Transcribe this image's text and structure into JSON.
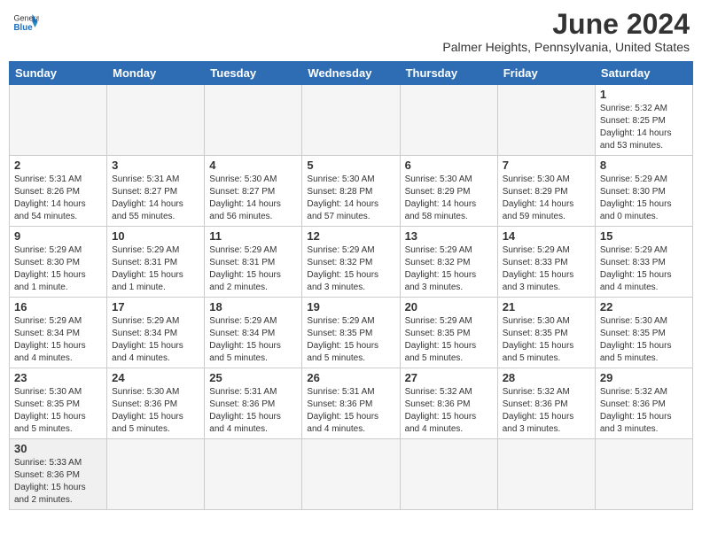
{
  "header": {
    "logo_general": "General",
    "logo_blue": "Blue",
    "month_title": "June 2024",
    "location": "Palmer Heights, Pennsylvania, United States"
  },
  "days_of_week": [
    "Sunday",
    "Monday",
    "Tuesday",
    "Wednesday",
    "Thursday",
    "Friday",
    "Saturday"
  ],
  "weeks": [
    [
      {
        "day": "",
        "info": ""
      },
      {
        "day": "",
        "info": ""
      },
      {
        "day": "",
        "info": ""
      },
      {
        "day": "",
        "info": ""
      },
      {
        "day": "",
        "info": ""
      },
      {
        "day": "",
        "info": ""
      },
      {
        "day": "1",
        "info": "Sunrise: 5:32 AM\nSunset: 8:25 PM\nDaylight: 14 hours\nand 53 minutes."
      }
    ],
    [
      {
        "day": "2",
        "info": "Sunrise: 5:31 AM\nSunset: 8:26 PM\nDaylight: 14 hours\nand 54 minutes."
      },
      {
        "day": "3",
        "info": "Sunrise: 5:31 AM\nSunset: 8:27 PM\nDaylight: 14 hours\nand 55 minutes."
      },
      {
        "day": "4",
        "info": "Sunrise: 5:30 AM\nSunset: 8:27 PM\nDaylight: 14 hours\nand 56 minutes."
      },
      {
        "day": "5",
        "info": "Sunrise: 5:30 AM\nSunset: 8:28 PM\nDaylight: 14 hours\nand 57 minutes."
      },
      {
        "day": "6",
        "info": "Sunrise: 5:30 AM\nSunset: 8:29 PM\nDaylight: 14 hours\nand 58 minutes."
      },
      {
        "day": "7",
        "info": "Sunrise: 5:30 AM\nSunset: 8:29 PM\nDaylight: 14 hours\nand 59 minutes."
      },
      {
        "day": "8",
        "info": "Sunrise: 5:29 AM\nSunset: 8:30 PM\nDaylight: 15 hours\nand 0 minutes."
      }
    ],
    [
      {
        "day": "9",
        "info": "Sunrise: 5:29 AM\nSunset: 8:30 PM\nDaylight: 15 hours\nand 1 minute."
      },
      {
        "day": "10",
        "info": "Sunrise: 5:29 AM\nSunset: 8:31 PM\nDaylight: 15 hours\nand 1 minute."
      },
      {
        "day": "11",
        "info": "Sunrise: 5:29 AM\nSunset: 8:31 PM\nDaylight: 15 hours\nand 2 minutes."
      },
      {
        "day": "12",
        "info": "Sunrise: 5:29 AM\nSunset: 8:32 PM\nDaylight: 15 hours\nand 3 minutes."
      },
      {
        "day": "13",
        "info": "Sunrise: 5:29 AM\nSunset: 8:32 PM\nDaylight: 15 hours\nand 3 minutes."
      },
      {
        "day": "14",
        "info": "Sunrise: 5:29 AM\nSunset: 8:33 PM\nDaylight: 15 hours\nand 3 minutes."
      },
      {
        "day": "15",
        "info": "Sunrise: 5:29 AM\nSunset: 8:33 PM\nDaylight: 15 hours\nand 4 minutes."
      }
    ],
    [
      {
        "day": "16",
        "info": "Sunrise: 5:29 AM\nSunset: 8:34 PM\nDaylight: 15 hours\nand 4 minutes."
      },
      {
        "day": "17",
        "info": "Sunrise: 5:29 AM\nSunset: 8:34 PM\nDaylight: 15 hours\nand 4 minutes."
      },
      {
        "day": "18",
        "info": "Sunrise: 5:29 AM\nSunset: 8:34 PM\nDaylight: 15 hours\nand 5 minutes."
      },
      {
        "day": "19",
        "info": "Sunrise: 5:29 AM\nSunset: 8:35 PM\nDaylight: 15 hours\nand 5 minutes."
      },
      {
        "day": "20",
        "info": "Sunrise: 5:29 AM\nSunset: 8:35 PM\nDaylight: 15 hours\nand 5 minutes."
      },
      {
        "day": "21",
        "info": "Sunrise: 5:30 AM\nSunset: 8:35 PM\nDaylight: 15 hours\nand 5 minutes."
      },
      {
        "day": "22",
        "info": "Sunrise: 5:30 AM\nSunset: 8:35 PM\nDaylight: 15 hours\nand 5 minutes."
      }
    ],
    [
      {
        "day": "23",
        "info": "Sunrise: 5:30 AM\nSunset: 8:35 PM\nDaylight: 15 hours\nand 5 minutes."
      },
      {
        "day": "24",
        "info": "Sunrise: 5:30 AM\nSunset: 8:36 PM\nDaylight: 15 hours\nand 5 minutes."
      },
      {
        "day": "25",
        "info": "Sunrise: 5:31 AM\nSunset: 8:36 PM\nDaylight: 15 hours\nand 4 minutes."
      },
      {
        "day": "26",
        "info": "Sunrise: 5:31 AM\nSunset: 8:36 PM\nDaylight: 15 hours\nand 4 minutes."
      },
      {
        "day": "27",
        "info": "Sunrise: 5:32 AM\nSunset: 8:36 PM\nDaylight: 15 hours\nand 4 minutes."
      },
      {
        "day": "28",
        "info": "Sunrise: 5:32 AM\nSunset: 8:36 PM\nDaylight: 15 hours\nand 3 minutes."
      },
      {
        "day": "29",
        "info": "Sunrise: 5:32 AM\nSunset: 8:36 PM\nDaylight: 15 hours\nand 3 minutes."
      }
    ],
    [
      {
        "day": "30",
        "info": "Sunrise: 5:33 AM\nSunset: 8:36 PM\nDaylight: 15 hours\nand 2 minutes."
      },
      {
        "day": "",
        "info": ""
      },
      {
        "day": "",
        "info": ""
      },
      {
        "day": "",
        "info": ""
      },
      {
        "day": "",
        "info": ""
      },
      {
        "day": "",
        "info": ""
      },
      {
        "day": "",
        "info": ""
      }
    ]
  ]
}
